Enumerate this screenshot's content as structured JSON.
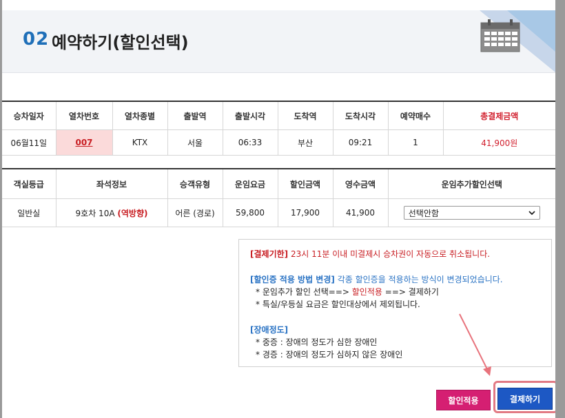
{
  "header": {
    "step_number": "02",
    "title": "예약하기(할인선택)"
  },
  "booking_table": {
    "headers": [
      "승차일자",
      "열차번호",
      "열차종별",
      "출발역",
      "출발시각",
      "도착역",
      "도착시각",
      "예약매수",
      "총결제금액"
    ],
    "row": {
      "date": "06월11일",
      "train_no": "007",
      "train_type": "KTX",
      "departure_station": "서울",
      "departure_time": "06:33",
      "arrival_station": "부산",
      "arrival_time": "09:21",
      "tickets": "1",
      "total": "41,900원"
    }
  },
  "fare_table": {
    "headers": [
      "객실등급",
      "좌석정보",
      "승객유형",
      "운임요금",
      "할인금액",
      "영수금액",
      "운임추가할인선택"
    ],
    "row": {
      "class": "일반실",
      "seat": "9호차 10A",
      "seat_direction": "(역방향)",
      "passenger_type": "어른 (경로)",
      "fare": "59,800",
      "discount": "17,900",
      "received": "41,900",
      "discount_select": "선택안함"
    }
  },
  "notice": {
    "deadline_label": "[결제기한]",
    "deadline_text": "23시 11분 이내 미결제시 승차권이 자동으로 취소됩니다.",
    "method_label": "[할인증 적용 방법 변경]",
    "method_text": "각종 할인증을 적용하는 방식이 변경되었습니다.",
    "method_step_pre": "* 운임추가 할인 선택==>",
    "method_step_mid": "할인적용",
    "method_step_post": "==> 결제하기",
    "method_note": "* 특실/우등실 요금은 할인대상에서 제외됩니다.",
    "disability_label": "[장애정도]",
    "severe": "* 중증 : 장애의 정도가 심한 장애인",
    "mild": "* 경증 : 장애의 정도가 심하지 않은 장애인"
  },
  "buttons": {
    "apply_discount": "할인적용",
    "pay": "결제하기"
  },
  "colors": {
    "accent_blue": "#1f6fb8",
    "highlight_red": "#c81d22",
    "apply_button": "#d51f72",
    "pay_button": "#1d58c4"
  }
}
